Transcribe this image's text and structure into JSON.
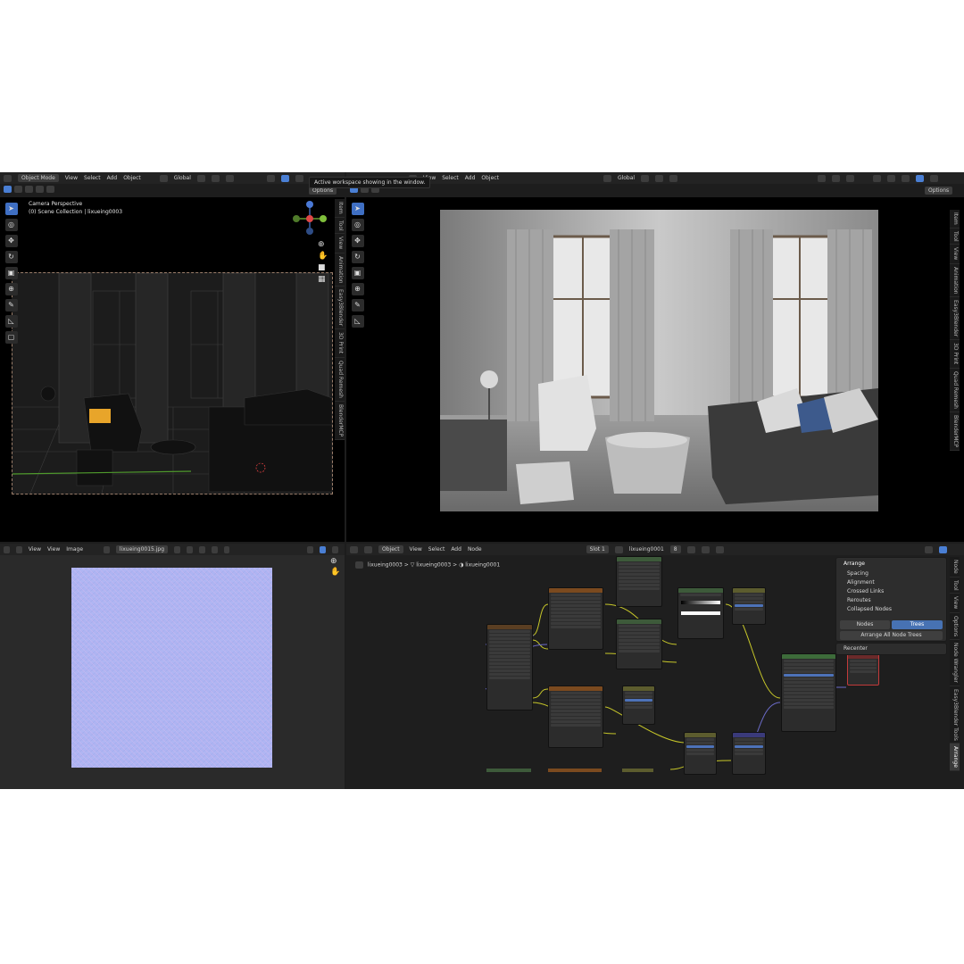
{
  "tooltip": "Active workspace showing in the window.",
  "left_viewport": {
    "mode": "Object Mode",
    "menus": [
      "View",
      "Select",
      "Add",
      "Object"
    ],
    "transform": "Global",
    "options": "Options",
    "camera_label": "Camera Perspective",
    "collection_label": "(0) Scene Collection | lixueing0003",
    "tabs": [
      "Item",
      "Tool",
      "View",
      "Animation",
      "Easy3Blender",
      "3D Print",
      "Quad Remesh",
      "BlenderMCP"
    ]
  },
  "right_viewport": {
    "menus": [
      "View",
      "Select",
      "Add",
      "Object"
    ],
    "transform": "Global",
    "options": "Options",
    "tabs": [
      "Item",
      "Tool",
      "View",
      "Animation",
      "Easy3Blender",
      "3D Print",
      "Quad Remesh",
      "BlenderMCP"
    ]
  },
  "image_editor": {
    "menus": [
      "View",
      "View",
      "Image"
    ],
    "filename": "lixueing0015.jpg"
  },
  "node_editor": {
    "object": "Object",
    "menus": [
      "View",
      "Select",
      "Add",
      "Node"
    ],
    "slot": "Slot 1",
    "material": "lixueing0001",
    "users": "8",
    "breadcrumb": [
      "lixueing0003",
      "lixueing0003",
      "lixueing0001"
    ],
    "arrange_panel": {
      "title": "Arrange",
      "items": [
        "Spacing",
        "Alignment",
        "Crossed Links",
        "Reroutes",
        "Collapsed Nodes"
      ],
      "nodes_label": "Nodes",
      "trees_label": "Trees",
      "arrange_all": "Arrange All Node Trees",
      "recenter": "Recenter"
    },
    "tabs": [
      "Node",
      "Tool",
      "View",
      "Options",
      "Node Wrangler",
      "Easy3Blender Tools",
      "Arrange"
    ]
  }
}
